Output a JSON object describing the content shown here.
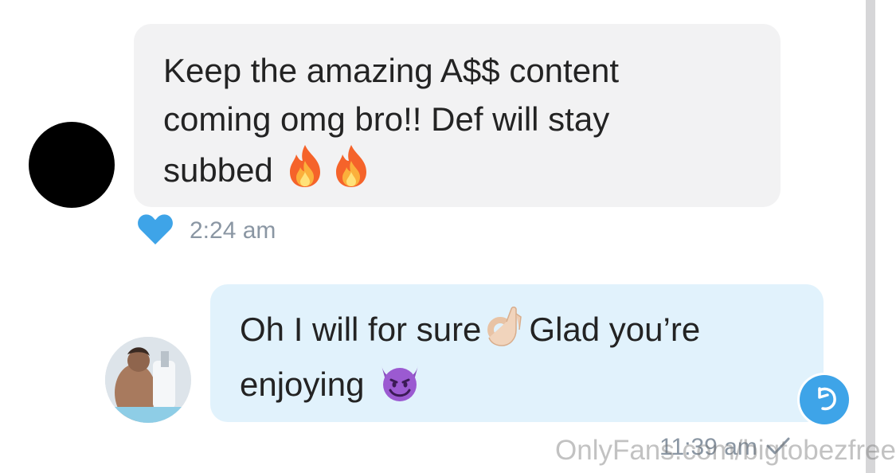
{
  "incoming_message": {
    "text_line1": "Keep the amazing A$$ content",
    "text_line2": "coming omg bro!! Def will stay",
    "text_line3": "subbed",
    "emojis": [
      "fire-emoji",
      "fire-emoji"
    ],
    "time": "2:24 am",
    "liked": true,
    "heart_color": "#3ea4e8"
  },
  "outgoing_message": {
    "text_part1": "Oh I will for sure",
    "emoji_after_part1": "ok-hand-emoji",
    "text_part2": "Glad you’re",
    "text_line2": "enjoying",
    "emoji_end": "smiling-devil-emoji",
    "time": "11:39 am",
    "status_icon": "check-icon"
  },
  "reply_button_icon": "undo-reply-icon",
  "watermark": "OnlyFans.com/bigtobezfree",
  "colors": {
    "incoming_bubble": "#f2f2f3",
    "outgoing_bubble": "#e1f2fc",
    "accent": "#3ea4e8",
    "meta_text": "#8a96a3"
  }
}
